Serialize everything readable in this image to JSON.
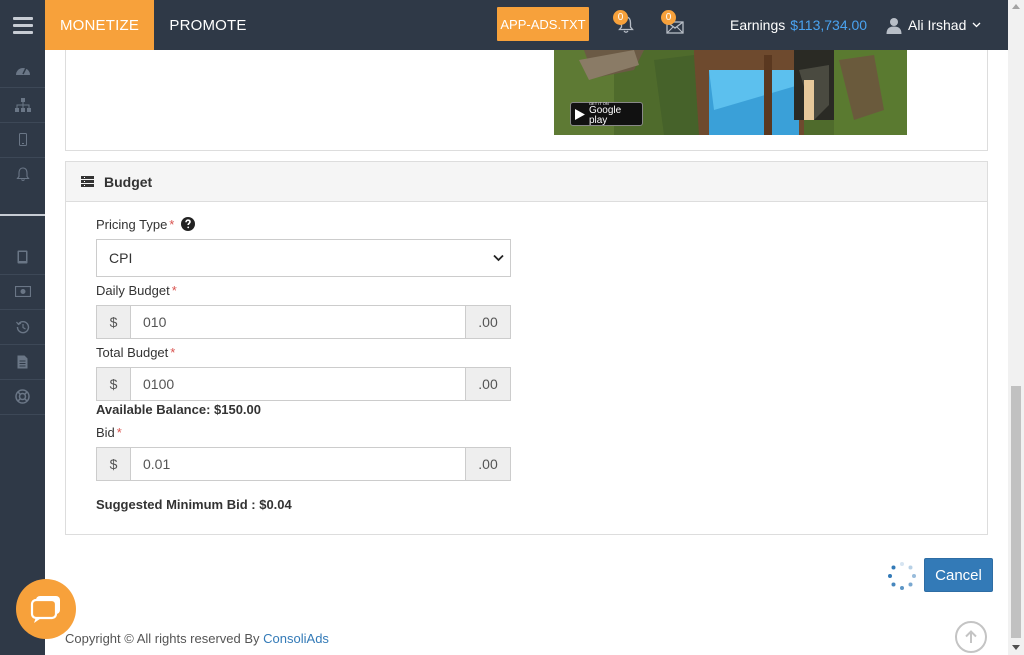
{
  "header": {
    "nav_monetize": "MONETIZE",
    "nav_promote": "PROMOTE",
    "app_ads_button": "APP-ADS.TXT",
    "notifications_count": "0",
    "messages_count": "0",
    "earnings_label": "Earnings",
    "earnings_value": "$113,734.00",
    "user_name": "Ali Irshad"
  },
  "sidebar": {
    "icons": [
      "dashboard-icon",
      "sitemap-icon",
      "mobile-icon",
      "bell-icon",
      "tablet-icon",
      "money-icon",
      "history-icon",
      "document-icon",
      "lifebuoy-icon"
    ]
  },
  "budget": {
    "title": "Budget",
    "pricing_type_label": "Pricing Type",
    "pricing_type_value": "CPI",
    "daily_budget_label": "Daily Budget",
    "daily_budget_value": "010",
    "total_budget_label": "Total Budget",
    "total_budget_value": "0100",
    "available_balance": "Available Balance: $150.00",
    "bid_label": "Bid",
    "bid_value": "0.01",
    "currency_symbol": "$",
    "decimal_suffix": ".00",
    "suggested_min_bid": "Suggested Minimum Bid : $0.04",
    "required_marker": "*"
  },
  "actions": {
    "cancel_label": "Cancel"
  },
  "footer": {
    "copyright_text": "Copyright © All rights reserved By",
    "company_link": "ConsoliAds"
  },
  "image": {
    "badge_small_text": "GET IT ON",
    "badge_text": "Google play"
  },
  "colors": {
    "accent_orange": "#f7a13b",
    "navbar": "#2f3947",
    "primary_blue": "#337ab7"
  }
}
